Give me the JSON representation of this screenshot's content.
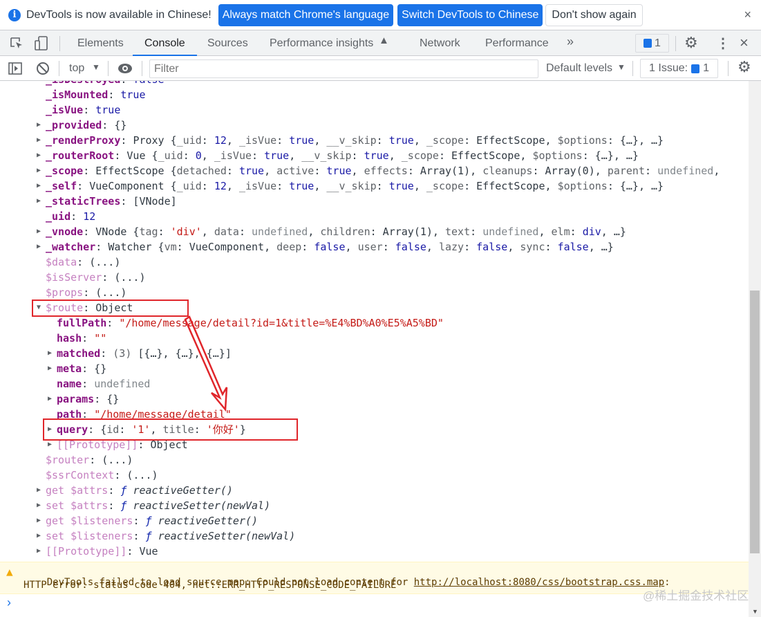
{
  "infobar": {
    "message": "DevTools is now available in Chinese!",
    "btn_match": "Always match Chrome's language",
    "btn_switch": "Switch DevTools to Chinese",
    "btn_dont": "Don't show again",
    "close": "×"
  },
  "tabs": {
    "items": [
      "Elements",
      "Console",
      "Sources",
      "Performance insights",
      "Network",
      "Performance"
    ],
    "active": "Console",
    "more": "»",
    "issues_badge": "1",
    "close": "×"
  },
  "toolbar": {
    "context": "top",
    "filter_placeholder": "Filter",
    "levels": "Default levels",
    "issues": "1 Issue:",
    "issues_count": "1"
  },
  "console_lines": [
    {
      "lvl": 0,
      "arrow": "",
      "seg": [
        [
          "k",
          "_isDestroyed"
        ],
        [
          "p",
          ": "
        ],
        [
          "n",
          "false"
        ]
      ]
    },
    {
      "lvl": 0,
      "arrow": "",
      "seg": [
        [
          "k",
          "_isMounted"
        ],
        [
          "p",
          ": "
        ],
        [
          "n",
          "true"
        ]
      ]
    },
    {
      "lvl": 0,
      "arrow": "",
      "seg": [
        [
          "k",
          "_isVue"
        ],
        [
          "p",
          ": "
        ],
        [
          "n",
          "true"
        ]
      ]
    },
    {
      "lvl": 0,
      "arrow": "r",
      "seg": [
        [
          "k",
          "_provided"
        ],
        [
          "p",
          ": {}"
        ]
      ]
    },
    {
      "lvl": 0,
      "arrow": "r",
      "seg": [
        [
          "k",
          "_renderProxy"
        ],
        [
          "p",
          ": "
        ],
        [
          "o",
          "Proxy {"
        ],
        [
          "pk",
          "_uid"
        ],
        [
          "p",
          ": "
        ],
        [
          "n",
          "12"
        ],
        [
          "p",
          ", "
        ],
        [
          "pk",
          "_isVue"
        ],
        [
          "p",
          ": "
        ],
        [
          "n",
          "true"
        ],
        [
          "p",
          ", "
        ],
        [
          "pk",
          "__v_skip"
        ],
        [
          "p",
          ": "
        ],
        [
          "n",
          "true"
        ],
        [
          "p",
          ", "
        ],
        [
          "pk",
          "_scope"
        ],
        [
          "p",
          ": EffectScope, "
        ],
        [
          "pk",
          "$options"
        ],
        [
          "p",
          ": {…}, …}"
        ]
      ]
    },
    {
      "lvl": 0,
      "arrow": "r",
      "seg": [
        [
          "k",
          "_routerRoot"
        ],
        [
          "p",
          ": "
        ],
        [
          "o",
          "Vue {"
        ],
        [
          "pk",
          "_uid"
        ],
        [
          "p",
          ": "
        ],
        [
          "n",
          "0"
        ],
        [
          "p",
          ", "
        ],
        [
          "pk",
          "_isVue"
        ],
        [
          "p",
          ": "
        ],
        [
          "n",
          "true"
        ],
        [
          "p",
          ", "
        ],
        [
          "pk",
          "__v_skip"
        ],
        [
          "p",
          ": "
        ],
        [
          "n",
          "true"
        ],
        [
          "p",
          ", "
        ],
        [
          "pk",
          "_scope"
        ],
        [
          "p",
          ": EffectScope, "
        ],
        [
          "pk",
          "$options"
        ],
        [
          "p",
          ": {…}, …}"
        ]
      ]
    },
    {
      "lvl": 0,
      "arrow": "r",
      "seg": [
        [
          "k",
          "_scope"
        ],
        [
          "p",
          ": "
        ],
        [
          "o",
          "EffectScope {"
        ],
        [
          "pk",
          "detached"
        ],
        [
          "p",
          ": "
        ],
        [
          "n",
          "true"
        ],
        [
          "p",
          ", "
        ],
        [
          "pk",
          "active"
        ],
        [
          "p",
          ": "
        ],
        [
          "n",
          "true"
        ],
        [
          "p",
          ", "
        ],
        [
          "pk",
          "effects"
        ],
        [
          "p",
          ": Array(1), "
        ],
        [
          "pk",
          "cleanups"
        ],
        [
          "p",
          ": Array(0), "
        ],
        [
          "pk",
          "parent"
        ],
        [
          "p",
          ": "
        ],
        [
          "u",
          "undefined"
        ],
        [
          "p",
          ","
        ]
      ]
    },
    {
      "lvl": 0,
      "arrow": "r",
      "seg": [
        [
          "k",
          "_self"
        ],
        [
          "p",
          ": "
        ],
        [
          "o",
          "VueComponent {"
        ],
        [
          "pk",
          "_uid"
        ],
        [
          "p",
          ": "
        ],
        [
          "n",
          "12"
        ],
        [
          "p",
          ", "
        ],
        [
          "pk",
          "_isVue"
        ],
        [
          "p",
          ": "
        ],
        [
          "n",
          "true"
        ],
        [
          "p",
          ", "
        ],
        [
          "pk",
          "__v_skip"
        ],
        [
          "p",
          ": "
        ],
        [
          "n",
          "true"
        ],
        [
          "p",
          ", "
        ],
        [
          "pk",
          "_scope"
        ],
        [
          "p",
          ": EffectScope, "
        ],
        [
          "pk",
          "$options"
        ],
        [
          "p",
          ": {…}, …}"
        ]
      ]
    },
    {
      "lvl": 0,
      "arrow": "r",
      "seg": [
        [
          "k",
          "_staticTrees"
        ],
        [
          "p",
          ": [VNode]"
        ]
      ]
    },
    {
      "lvl": 0,
      "arrow": "",
      "seg": [
        [
          "k",
          "_uid"
        ],
        [
          "p",
          ": "
        ],
        [
          "n",
          "12"
        ]
      ]
    },
    {
      "lvl": 0,
      "arrow": "r",
      "seg": [
        [
          "k",
          "_vnode"
        ],
        [
          "p",
          ": "
        ],
        [
          "o",
          "VNode {"
        ],
        [
          "pk",
          "tag"
        ],
        [
          "p",
          ": "
        ],
        [
          "s",
          "'div'"
        ],
        [
          "p",
          ", "
        ],
        [
          "pk",
          "data"
        ],
        [
          "p",
          ": "
        ],
        [
          "u",
          "undefined"
        ],
        [
          "p",
          ", "
        ],
        [
          "pk",
          "children"
        ],
        [
          "p",
          ": Array(1), "
        ],
        [
          "pk",
          "text"
        ],
        [
          "p",
          ": "
        ],
        [
          "u",
          "undefined"
        ],
        [
          "p",
          ", "
        ],
        [
          "pk",
          "elm"
        ],
        [
          "p",
          ": "
        ],
        [
          "n",
          "div"
        ],
        [
          "p",
          ", …}"
        ]
      ]
    },
    {
      "lvl": 0,
      "arrow": "r",
      "seg": [
        [
          "k",
          "_watcher"
        ],
        [
          "p",
          ": "
        ],
        [
          "o",
          "Watcher {"
        ],
        [
          "pk",
          "vm"
        ],
        [
          "p",
          ": VueComponent, "
        ],
        [
          "pk",
          "deep"
        ],
        [
          "p",
          ": "
        ],
        [
          "n",
          "false"
        ],
        [
          "p",
          ", "
        ],
        [
          "pk",
          "user"
        ],
        [
          "p",
          ": "
        ],
        [
          "n",
          "false"
        ],
        [
          "p",
          ", "
        ],
        [
          "pk",
          "lazy"
        ],
        [
          "p",
          ": "
        ],
        [
          "n",
          "false"
        ],
        [
          "p",
          ", "
        ],
        [
          "pk",
          "sync"
        ],
        [
          "p",
          ": "
        ],
        [
          "n",
          "false"
        ],
        [
          "p",
          ", …}"
        ]
      ]
    },
    {
      "lvl": 0,
      "arrow": "",
      "seg": [
        [
          "kd",
          "$data"
        ],
        [
          "p",
          ": (...)"
        ]
      ]
    },
    {
      "lvl": 0,
      "arrow": "",
      "seg": [
        [
          "kd",
          "$isServer"
        ],
        [
          "p",
          ": (...)"
        ]
      ]
    },
    {
      "lvl": 0,
      "arrow": "",
      "seg": [
        [
          "kd",
          "$props"
        ],
        [
          "p",
          ": (...)"
        ]
      ]
    },
    {
      "lvl": 0,
      "arrow": "d",
      "seg": [
        [
          "kd",
          "$route"
        ],
        [
          "p",
          ": Object"
        ]
      ]
    },
    {
      "lvl": 1,
      "arrow": "",
      "seg": [
        [
          "k",
          "fullPath"
        ],
        [
          "p",
          ": "
        ],
        [
          "s",
          "\"/home/message/detail?id=1&title=%E4%BD%A0%E5%A5%BD\""
        ]
      ]
    },
    {
      "lvl": 1,
      "arrow": "",
      "seg": [
        [
          "k",
          "hash"
        ],
        [
          "p",
          ": "
        ],
        [
          "s",
          "\"\""
        ]
      ]
    },
    {
      "lvl": 1,
      "arrow": "r",
      "seg": [
        [
          "k",
          "matched"
        ],
        [
          "p",
          ": "
        ],
        [
          "pk",
          "(3) "
        ],
        [
          "p",
          "[{…}, {…}, {…}]"
        ]
      ]
    },
    {
      "lvl": 1,
      "arrow": "r",
      "seg": [
        [
          "k",
          "meta"
        ],
        [
          "p",
          ": {}"
        ]
      ]
    },
    {
      "lvl": 1,
      "arrow": "",
      "seg": [
        [
          "k",
          "name"
        ],
        [
          "p",
          ": "
        ],
        [
          "u",
          "undefined"
        ]
      ]
    },
    {
      "lvl": 1,
      "arrow": "r",
      "seg": [
        [
          "k",
          "params"
        ],
        [
          "p",
          ": {}"
        ]
      ]
    },
    {
      "lvl": 1,
      "arrow": "",
      "seg": [
        [
          "k",
          "path"
        ],
        [
          "p",
          ": "
        ],
        [
          "s",
          "\"/home/message/detail\""
        ]
      ]
    },
    {
      "lvl": 1,
      "arrow": "r",
      "seg": [
        [
          "k",
          "query"
        ],
        [
          "p",
          ": {"
        ],
        [
          "pk",
          "id"
        ],
        [
          "p",
          ": "
        ],
        [
          "s",
          "'1'"
        ],
        [
          "p",
          ", "
        ],
        [
          "pk",
          "title"
        ],
        [
          "p",
          ": "
        ],
        [
          "s",
          "'你好'"
        ],
        [
          "p",
          "}"
        ]
      ]
    },
    {
      "lvl": 1,
      "arrow": "r",
      "seg": [
        [
          "kd",
          "[[Prototype]]"
        ],
        [
          "p",
          ": Object"
        ]
      ]
    },
    {
      "lvl": 0,
      "arrow": "",
      "seg": [
        [
          "kd",
          "$router"
        ],
        [
          "p",
          ": (...)"
        ]
      ]
    },
    {
      "lvl": 0,
      "arrow": "",
      "seg": [
        [
          "kd",
          "$ssrContext"
        ],
        [
          "p",
          ": (...)"
        ]
      ]
    },
    {
      "lvl": -1,
      "arrow": "r",
      "seg": [
        [
          "kd",
          "get $attrs"
        ],
        [
          "p",
          ": "
        ],
        [
          "fk",
          "ƒ "
        ],
        [
          "f",
          "reactiveGetter()"
        ]
      ]
    },
    {
      "lvl": -1,
      "arrow": "r",
      "seg": [
        [
          "kd",
          "set $attrs"
        ],
        [
          "p",
          ": "
        ],
        [
          "fk",
          "ƒ "
        ],
        [
          "f",
          "reactiveSetter(newVal)"
        ]
      ]
    },
    {
      "lvl": -1,
      "arrow": "r",
      "seg": [
        [
          "kd",
          "get $listeners"
        ],
        [
          "p",
          ": "
        ],
        [
          "fk",
          "ƒ "
        ],
        [
          "f",
          "reactiveGetter()"
        ]
      ]
    },
    {
      "lvl": -1,
      "arrow": "r",
      "seg": [
        [
          "kd",
          "set $listeners"
        ],
        [
          "p",
          ": "
        ],
        [
          "fk",
          "ƒ "
        ],
        [
          "f",
          "reactiveSetter(newVal)"
        ]
      ]
    },
    {
      "lvl": -1,
      "arrow": "r",
      "seg": [
        [
          "kd",
          "[[Prototype]]"
        ],
        [
          "p",
          ": Vue"
        ]
      ]
    }
  ],
  "warning": {
    "icon": "warning-triangle-icon",
    "text1": "DevTools failed to load source map: Could not load content for ",
    "link": "http://localhost:8080/css/bootstrap.css.map",
    "text2": ":",
    "line2": "HTTP error: status code 404, net::ERR_HTTP_RESPONSE_CODE_FAILURE"
  },
  "prompt": "›",
  "watermark": "@稀土掘金技术社区",
  "colors": {
    "accent": "#1a73e8",
    "highlight_box": "#e0262b",
    "key": "#881280",
    "string": "#c41a16",
    "number": "#1a1aa6"
  }
}
